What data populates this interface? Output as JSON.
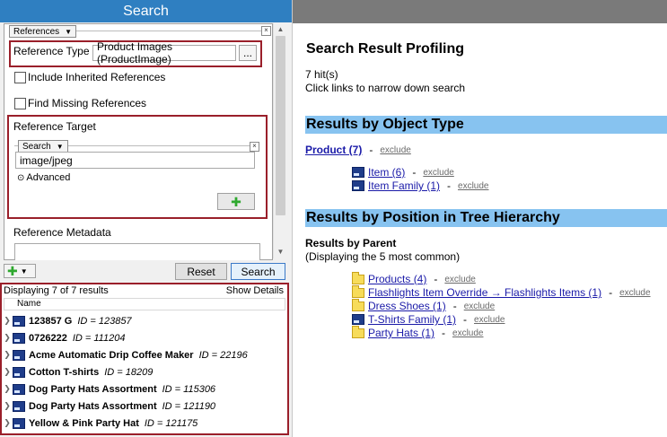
{
  "left": {
    "title": "Search",
    "references_tab": "References",
    "reference_type_label": "Reference Type",
    "reference_type_value": "Product Images (ProductImage)",
    "browse_label": "...",
    "include_inherited": "Include Inherited References",
    "find_missing": "Find Missing References",
    "reference_target_label": "Reference Target",
    "search_tab": "Search",
    "search_value": "image/jpeg",
    "advanced_label": "Advanced",
    "reference_metadata_label": "Reference Metadata",
    "reset_label": "Reset",
    "search_label": "Search",
    "results_summary": "Displaying 7 of 7 results",
    "show_details": "Show Details",
    "name_header": "Name",
    "rows": [
      {
        "name": "123857 G",
        "id": "ID = 123857"
      },
      {
        "name": "0726222",
        "id": "ID = 111204"
      },
      {
        "name": "Acme Automatic Drip Coffee Maker",
        "id": "ID = 22196"
      },
      {
        "name": "Cotton T-shirts",
        "id": "ID = 18209"
      },
      {
        "name": "Dog Party Hats Assortment",
        "id": "ID = 115306"
      },
      {
        "name": "Dog Party Hats Assortment",
        "id": "ID = 121190"
      },
      {
        "name": "Yellow & Pink Party Hat",
        "id": "ID = 121175"
      }
    ]
  },
  "right": {
    "heading": "Search Result Profiling",
    "hits": "7 hit(s)",
    "hint": "Click links to narrow down search",
    "section_object_type": "Results by Object Type",
    "product_link": "Product (7)",
    "dash": "-",
    "exclude": "exclude",
    "item_link": "Item (6)",
    "item_family_link": "Item Family (1)",
    "section_position": "Results by Position in Tree Hierarchy",
    "by_parent": "Results by Parent",
    "most_common": "(Displaying the 5 most common)",
    "parents": [
      {
        "label": "Products (4)",
        "icon": "folder-icon"
      },
      {
        "label": "Flashlights Item Override → Flashlights Items (1)",
        "icon": "folder-icon"
      },
      {
        "label": "Dress Shoes (1)",
        "icon": "folder-icon"
      },
      {
        "label": "T-Shirts Family (1)",
        "icon": "object-icon"
      },
      {
        "label": "Party Hats (1)",
        "icon": "folder-icon"
      }
    ]
  },
  "colors": {
    "title_bar": "#2f7fc1",
    "highlight_border": "#9a1f2a",
    "section_band": "#87c3f0",
    "link": "#1a1aa8"
  }
}
